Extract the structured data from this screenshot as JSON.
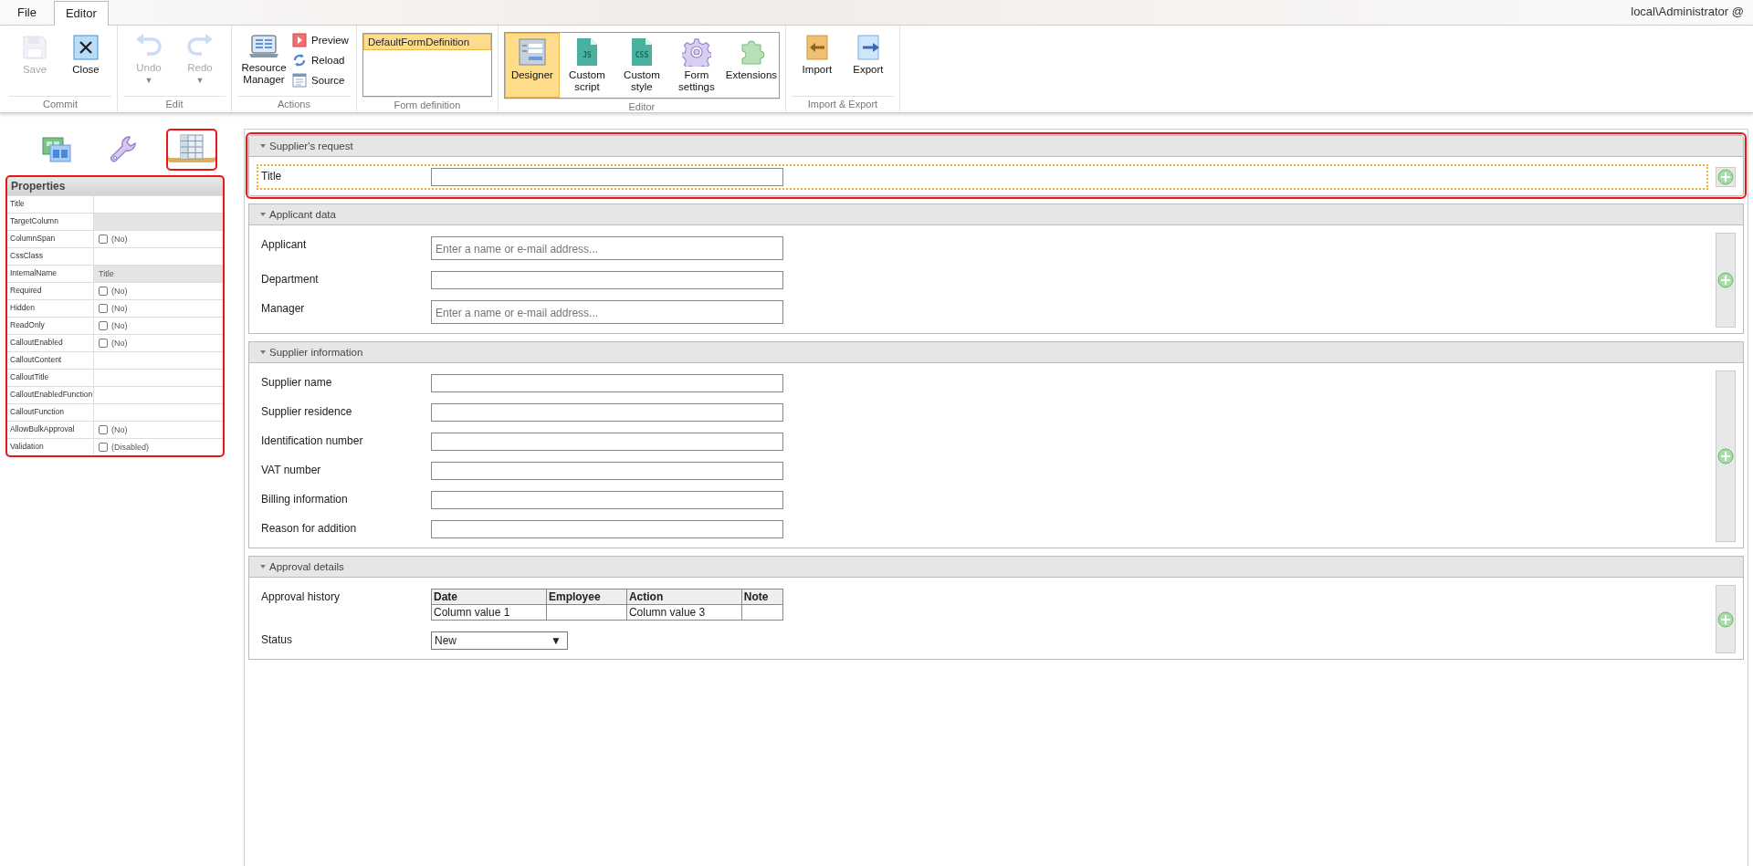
{
  "tabs": [
    {
      "label": "File",
      "selected": false
    },
    {
      "label": "Editor",
      "selected": true
    }
  ],
  "user": "local\\Administrator @",
  "ribbon": [
    {
      "label": "Commit",
      "kind": "buttons",
      "items": [
        {
          "kind": "save",
          "label": "Save",
          "disabled": true
        },
        {
          "kind": "close",
          "label": "Close",
          "disabled": false
        }
      ]
    },
    {
      "label": "Edit",
      "kind": "buttons",
      "items": [
        {
          "kind": "undo",
          "label": "Undo",
          "disabled": true,
          "arrow": "▼"
        },
        {
          "kind": "redo",
          "label": "Redo",
          "disabled": true,
          "arrow": "▼"
        }
      ]
    },
    {
      "label": "Actions",
      "kind": "actions",
      "items": [
        {
          "kind": "resource",
          "label": "Resource Manager"
        },
        {
          "kind": "preview",
          "label": "Preview"
        },
        {
          "kind": "reload",
          "label": "Reload"
        },
        {
          "kind": "source",
          "label": "Source"
        }
      ]
    },
    {
      "label": "Form definition",
      "kind": "list",
      "items": [
        {
          "label": "DefaultFormDefinition",
          "selected": true
        }
      ]
    },
    {
      "label": "Editor",
      "kind": "toggles",
      "items": [
        {
          "kind": "designer",
          "label": "Designer",
          "selected": true
        },
        {
          "kind": "doc",
          "badge": "JS",
          "label": "Custom script",
          "selected": false
        },
        {
          "kind": "doc",
          "badge": "CSS",
          "label": "Custom style",
          "selected": false
        },
        {
          "kind": "gear",
          "label": "Form settings",
          "selected": false
        },
        {
          "kind": "puzzle",
          "label": "Extensions",
          "selected": false
        }
      ]
    },
    {
      "label": "Import & Export",
      "kind": "buttons",
      "items": [
        {
          "kind": "import",
          "label": "Import",
          "disabled": false
        },
        {
          "kind": "export",
          "label": "Export",
          "disabled": false
        }
      ]
    }
  ],
  "panel_tabs": [
    {
      "kind": "layout",
      "selected": false,
      "highlighted": false
    },
    {
      "kind": "wrench",
      "selected": false,
      "highlighted": false
    },
    {
      "kind": "grid",
      "selected": true,
      "highlighted": true
    }
  ],
  "properties": {
    "title": "Properties",
    "highlighted": true,
    "rows": [
      {
        "name": "Title",
        "kind": "text",
        "disabled": false
      },
      {
        "name": "TargetColumn",
        "kind": "text",
        "disabled": true
      },
      {
        "name": "ColumnSpan",
        "kind": "checkbox",
        "checked": false,
        "value": "(No)"
      },
      {
        "name": "CssClass",
        "kind": "text",
        "disabled": false
      },
      {
        "name": "InternalName",
        "kind": "text",
        "value": "Title",
        "disabled": true
      },
      {
        "name": "Required",
        "kind": "checkbox",
        "checked": false,
        "value": "(No)"
      },
      {
        "name": "Hidden",
        "kind": "checkbox",
        "checked": false,
        "value": "(No)"
      },
      {
        "name": "ReadOnly",
        "kind": "checkbox",
        "checked": false,
        "value": "(No)"
      },
      {
        "name": "CalloutEnabled",
        "kind": "checkbox",
        "checked": false,
        "value": "(No)"
      },
      {
        "name": "CalloutContent",
        "kind": "text",
        "disabled": false
      },
      {
        "name": "CalloutTitle",
        "kind": "text",
        "disabled": false
      },
      {
        "name": "CalloutEnabledFunction",
        "kind": "text",
        "disabled": false
      },
      {
        "name": "CalloutFunction",
        "kind": "text",
        "disabled": false
      },
      {
        "name": "AllowBulkApproval",
        "kind": "checkbox",
        "checked": false,
        "value": "(No)"
      },
      {
        "name": "Validation",
        "kind": "checkbox",
        "checked": false,
        "value": "(Disabled)"
      }
    ]
  },
  "sections": [
    {
      "title": "Supplier's request",
      "expanded": true,
      "highlighted": true,
      "fields": [
        {
          "label": "Title",
          "kind": "text",
          "selected": true
        }
      ]
    },
    {
      "title": "Applicant data",
      "expanded": true,
      "highlighted": false,
      "fields": [
        {
          "label": "Applicant",
          "kind": "people",
          "placeholder": "Enter a name or e-mail address...",
          "selected": false
        },
        {
          "label": "Department",
          "kind": "text",
          "selected": false
        },
        {
          "label": "Manager",
          "kind": "people",
          "placeholder": "Enter a name or e-mail address...",
          "selected": false
        }
      ]
    },
    {
      "title": "Supplier information",
      "expanded": true,
      "highlighted": false,
      "fields": [
        {
          "label": "Supplier name",
          "kind": "text",
          "selected": false
        },
        {
          "label": "Supplier residence",
          "kind": "text",
          "selected": false
        },
        {
          "label": "Identification number",
          "kind": "text",
          "selected": false
        },
        {
          "label": "VAT number",
          "kind": "text",
          "selected": false
        },
        {
          "label": "Billing information",
          "kind": "text",
          "selected": false
        },
        {
          "label": "Reason for addition",
          "kind": "text",
          "selected": false
        }
      ]
    },
    {
      "title": "Approval details",
      "expanded": true,
      "highlighted": false,
      "fields": [
        {
          "label": "Approval history",
          "kind": "table",
          "selected": false,
          "columns": [
            "Date",
            "Employee",
            "Action",
            "Note"
          ],
          "rows": [
            [
              "Column value 1",
              "",
              "Column value 3",
              ""
            ]
          ]
        },
        {
          "label": "Status",
          "kind": "select",
          "value": "New",
          "arrow": "▼",
          "selected": false
        }
      ]
    }
  ]
}
